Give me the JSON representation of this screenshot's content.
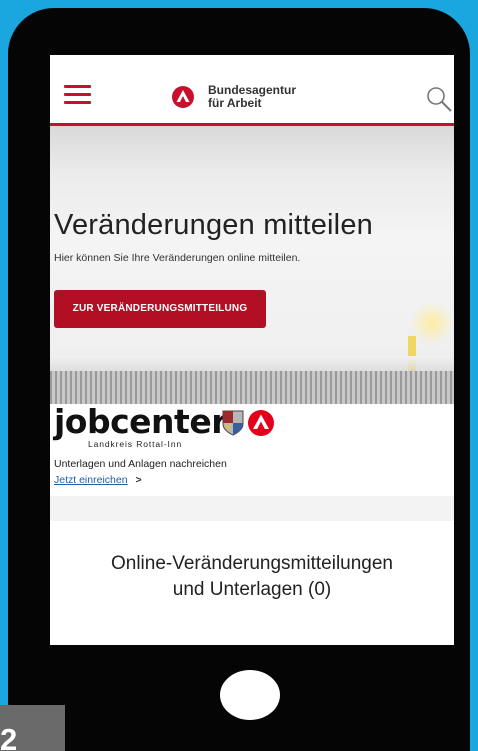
{
  "header": {
    "brand_line1": "Bundesagentur",
    "brand_line2": "für Arbeit"
  },
  "hero": {
    "title": "Veränderungen mitteilen",
    "description": "Hier können Sie Ihre Veränderungen online mitteilen.",
    "cta_label": "ZUR VERÄNDERUNGSMITTEILUNG"
  },
  "jobcenter": {
    "logo_word": "jobcenter",
    "region": "Landkreis Rottal-Inn",
    "text": "Unterlagen und Anlagen nachreichen",
    "link_label": "Jetzt einreichen",
    "link_chevron": ">"
  },
  "online": {
    "title_line1": "Online-Veränderungsmitteilungen",
    "title_line2": "und Unterlagen (0)"
  },
  "overlay": {
    "page_number": "2"
  },
  "colors": {
    "accent": "#c8102e",
    "button": "#b30f24",
    "link": "#1f5fa8",
    "frame_background": "#1aa6df"
  }
}
